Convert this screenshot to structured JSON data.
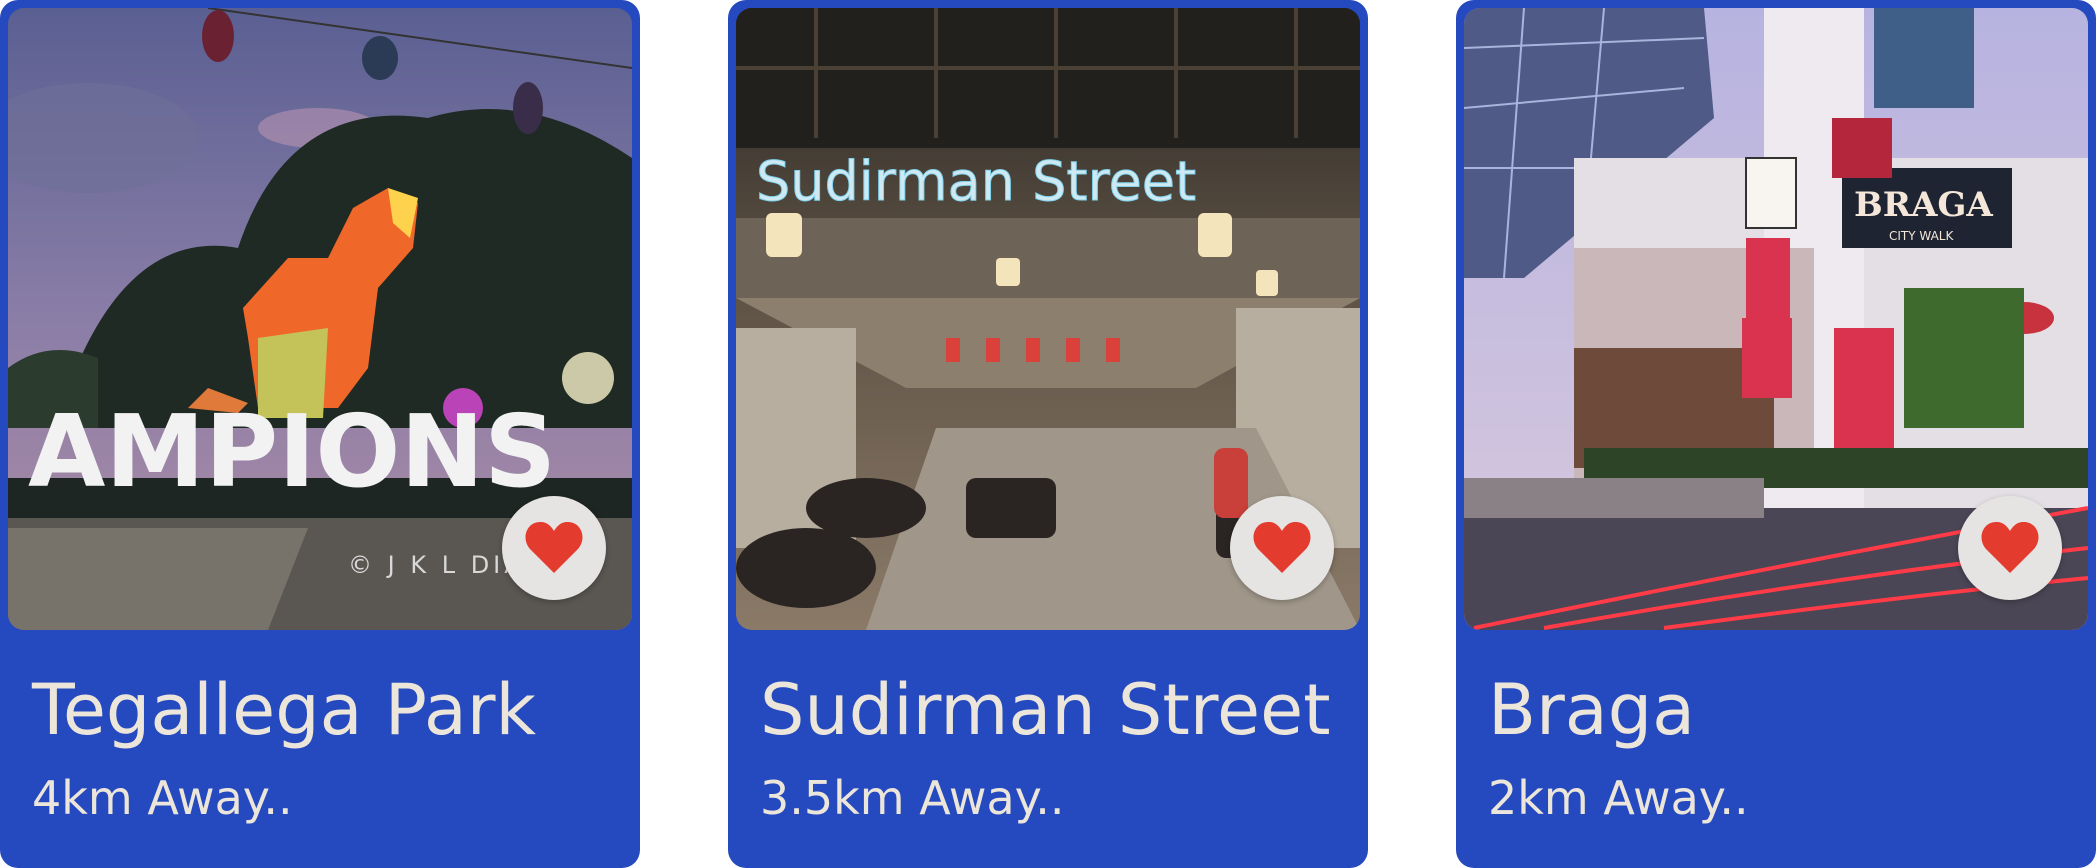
{
  "theme": {
    "card_color": "#2549bf",
    "text_color": "#ece6da",
    "heart_color": "#e33b2e",
    "fav_bg": "#e6e4e2"
  },
  "places": [
    {
      "name": "Tegallega Park",
      "distance": "4km Away..",
      "photo_sign": "AMPIONS",
      "photo_watermark": "© J K L DIA",
      "favorite_icon": "heart-icon"
    },
    {
      "name": "Sudirman Street",
      "distance": "3.5km Away..",
      "photo_sign": "Sudirman Street",
      "favorite_icon": "heart-icon"
    },
    {
      "name": "Braga",
      "distance": "2km Away..",
      "photo_sign": "BRAGA",
      "photo_sign_sub": "CITY WALK",
      "favorite_icon": "heart-icon"
    }
  ]
}
